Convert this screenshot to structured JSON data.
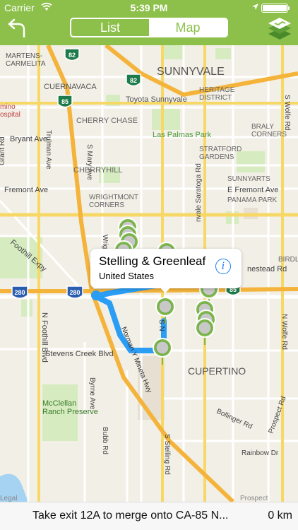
{
  "status_bar": {
    "carrier": "Carrier",
    "time": "5:39 PM",
    "battery_level": 1.0
  },
  "nav": {
    "back_icon": "back-arrow-icon",
    "tabs": [
      {
        "label": "List",
        "selected": false
      },
      {
        "label": "Map",
        "selected": true
      }
    ],
    "logo_icon": "app-logo-icon"
  },
  "colors": {
    "brand_green": "#8cc04a",
    "route_blue": "#2196f3",
    "pin_green": "#7db84c",
    "info_blue": "#1a7ef5"
  },
  "map": {
    "place_labels": [
      "MARTENS-\nCARMELITA",
      "SUNNYVALE",
      "CUERNAVACA",
      "HERITAGE\nDISTRICT",
      "Toyota Sunnyvale",
      "CHERRY CHASE",
      "Las Palmas Park",
      "BRALY\nCORNERS",
      "Bryant Ave",
      "STRATFORD\nGARDENS",
      "CHERRYHILL",
      "SUNNYARTS",
      "Fremont Ave",
      "WRIGHTMONT\nCORNERS",
      "E Fremont Ave",
      "PANAMA PARK",
      "Foothill Expy",
      "BIRDLA",
      "nestead Rd",
      "N Foothill Blvd",
      "Stevens Creek Blvd",
      "CUPERTINO",
      "Byrne Ave",
      "McClellan\nRanch Preserve",
      "Bubb Rd",
      "S Stelling Rd",
      "Bollinger Rd",
      "Rainbow Dr",
      "Legal",
      "Prospect",
      "Trulman Ave",
      "Grant Rd",
      "S Wolfe Rd",
      "N Wolfe Rd",
      "Norman Y Mineta Hwy",
      "nvale Saratoga Rd",
      "Wrig",
      "S Mary Ave",
      "mino\nospital",
      "Prospect Rd",
      "S N"
    ],
    "highway_shields": [
      "82",
      "82",
      "85",
      "280",
      "280",
      "85"
    ],
    "pin_count": 12
  },
  "callout": {
    "title": "Stelling & Greenleaf",
    "subtitle": "United States",
    "info_icon": "info-icon"
  },
  "direction": {
    "instruction": "Take exit 12A to merge onto CA-85 N...",
    "distance": "0 km"
  }
}
